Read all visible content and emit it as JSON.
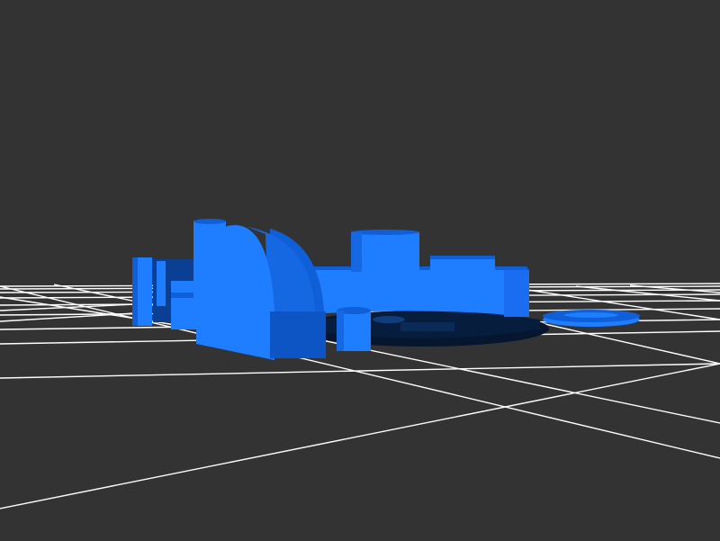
{
  "viewport": {
    "background_color": "#333333",
    "grid_line_color": "#ffffff",
    "model_color_light": "#1f7dff",
    "model_color_mid": "#0f5fd8",
    "model_color_dark": "#063f8f",
    "shadow_color": "#05162e"
  },
  "scene": {
    "view": "3d-perspective",
    "ground_grid": "visible",
    "model_parts": [
      "base-plate",
      "ring-wall",
      "arch-block",
      "tall-cylinder",
      "top-cylinder",
      "side-post",
      "small-cylinder",
      "flat-disc",
      "rear-block"
    ]
  }
}
